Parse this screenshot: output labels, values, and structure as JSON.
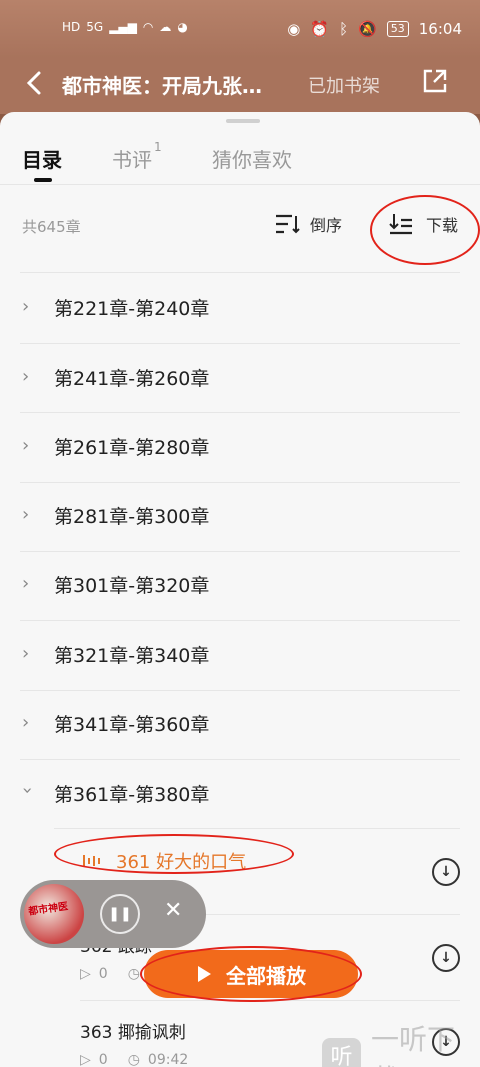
{
  "status_bar": {
    "left_icons": [
      "HD",
      "5G",
      "signal-icon",
      "wifi-icon",
      "cloud-icon",
      "wechat-icon"
    ],
    "right_icons": [
      "eye-icon",
      "alarm-icon",
      "bluetooth-icon",
      "mute-icon"
    ],
    "battery": "53",
    "time": "16:04"
  },
  "header": {
    "title": "都市神医：开局九张…",
    "shelf_label": "已加书架"
  },
  "tabs": [
    {
      "label": "目录",
      "active": true
    },
    {
      "label": "书评",
      "badge": "1"
    },
    {
      "label": "猜你喜欢"
    }
  ],
  "toolbar": {
    "chapter_count": "共645章",
    "reverse_label": "倒序",
    "download_label": "下载"
  },
  "chapter_groups": [
    {
      "label": "第221章-第240章"
    },
    {
      "label": "第241章-第260章"
    },
    {
      "label": "第261章-第280章"
    },
    {
      "label": "第281章-第300章"
    },
    {
      "label": "第301章-第320章"
    },
    {
      "label": "第321章-第340章"
    },
    {
      "label": "第341章-第360章"
    },
    {
      "label": "第361章-第380章",
      "expanded": true
    }
  ],
  "chapters": [
    {
      "title": "361 好大的口气",
      "playing": true
    },
    {
      "title": "362 跟踪",
      "plays": "0",
      "duration": ""
    },
    {
      "title": "363 揶揄讽刺",
      "plays": "0",
      "duration": "09:42"
    }
  ],
  "mini_player": {
    "cover_text": "都市神医"
  },
  "play_all_label": "全部播放",
  "watermark": {
    "icon": "听",
    "text": "一听下载"
  },
  "colors": {
    "accent": "#f26a1b",
    "playing": "#e5772a",
    "header": "#a8735c"
  }
}
